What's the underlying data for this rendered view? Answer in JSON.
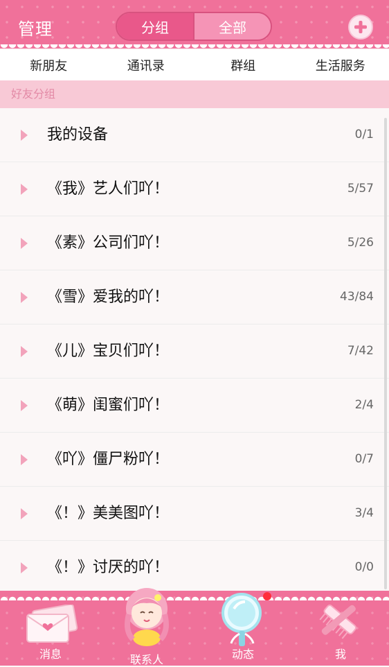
{
  "header": {
    "manage_label": "管理",
    "segments": [
      "分组",
      "全部"
    ]
  },
  "top_nav": [
    "新朋友",
    "通讯录",
    "群组",
    "生活服务"
  ],
  "section_title": "好友分组",
  "groups": [
    {
      "name": "我的设备",
      "count": "0/1"
    },
    {
      "name": "《我》艺人们吖！",
      "count": "5/57"
    },
    {
      "name": "《素》公司们吖！",
      "count": "5/26"
    },
    {
      "name": "《雪》爱我的吖！",
      "count": "43/84"
    },
    {
      "name": "《儿》宝贝们吖！",
      "count": "7/42"
    },
    {
      "name": "《萌》闺蜜们吖！",
      "count": "2/4"
    },
    {
      "name": "《吖》僵尸粉吖！",
      "count": "0/7"
    },
    {
      "name": "《！》美美图吖！",
      "count": "3/4"
    },
    {
      "name": "《！》讨厌的吖！",
      "count": "0/0"
    }
  ],
  "tabs": [
    {
      "label": "消息",
      "icon": "envelope-icon"
    },
    {
      "label": "联系人",
      "icon": "girl-avatar-icon"
    },
    {
      "label": "动态",
      "icon": "mirror-icon"
    },
    {
      "label": "我",
      "icon": "comb-icon"
    }
  ],
  "colors": {
    "primary_pink": "#f0719a",
    "section_bg": "#f8c9d6",
    "arrow": "#f2a3bb",
    "badge": "#ff2e3c"
  }
}
